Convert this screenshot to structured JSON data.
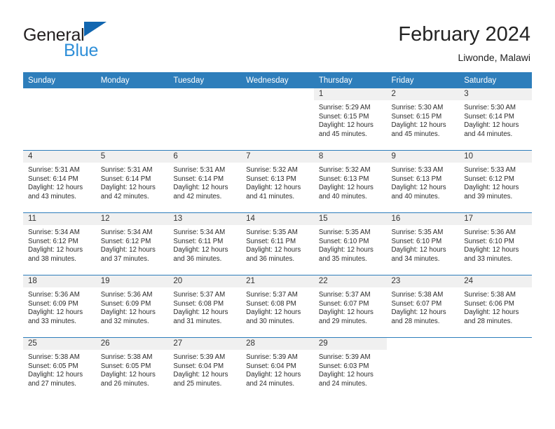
{
  "brand": {
    "name_top": "General",
    "name_bottom": "Blue",
    "triangle_color": "#1166b0",
    "bottom_color": "#2f8fd8"
  },
  "header": {
    "title": "February 2024",
    "subtitle": "Liwonde, Malawi"
  },
  "theme": {
    "header_bg": "#2e7ebb",
    "daynum_bg": "#f0f0f0",
    "rule_color": "#2e7ebb",
    "text_color": "#2b2b2b"
  },
  "weekday_headers": [
    "Sunday",
    "Monday",
    "Tuesday",
    "Wednesday",
    "Thursday",
    "Friday",
    "Saturday"
  ],
  "weeks": [
    [
      {
        "day": "",
        "blank": true,
        "sunrise": "",
        "sunset": "",
        "daylight1": "",
        "daylight2": ""
      },
      {
        "day": "",
        "blank": true,
        "sunrise": "",
        "sunset": "",
        "daylight1": "",
        "daylight2": ""
      },
      {
        "day": "",
        "blank": true,
        "sunrise": "",
        "sunset": "",
        "daylight1": "",
        "daylight2": ""
      },
      {
        "day": "",
        "blank": true,
        "sunrise": "",
        "sunset": "",
        "daylight1": "",
        "daylight2": ""
      },
      {
        "day": "1",
        "sunrise": "Sunrise: 5:29 AM",
        "sunset": "Sunset: 6:15 PM",
        "daylight1": "Daylight: 12 hours",
        "daylight2": "and 45 minutes."
      },
      {
        "day": "2",
        "sunrise": "Sunrise: 5:30 AM",
        "sunset": "Sunset: 6:15 PM",
        "daylight1": "Daylight: 12 hours",
        "daylight2": "and 45 minutes."
      },
      {
        "day": "3",
        "sunrise": "Sunrise: 5:30 AM",
        "sunset": "Sunset: 6:14 PM",
        "daylight1": "Daylight: 12 hours",
        "daylight2": "and 44 minutes."
      }
    ],
    [
      {
        "day": "4",
        "sunrise": "Sunrise: 5:31 AM",
        "sunset": "Sunset: 6:14 PM",
        "daylight1": "Daylight: 12 hours",
        "daylight2": "and 43 minutes."
      },
      {
        "day": "5",
        "sunrise": "Sunrise: 5:31 AM",
        "sunset": "Sunset: 6:14 PM",
        "daylight1": "Daylight: 12 hours",
        "daylight2": "and 42 minutes."
      },
      {
        "day": "6",
        "sunrise": "Sunrise: 5:31 AM",
        "sunset": "Sunset: 6:14 PM",
        "daylight1": "Daylight: 12 hours",
        "daylight2": "and 42 minutes."
      },
      {
        "day": "7",
        "sunrise": "Sunrise: 5:32 AM",
        "sunset": "Sunset: 6:13 PM",
        "daylight1": "Daylight: 12 hours",
        "daylight2": "and 41 minutes."
      },
      {
        "day": "8",
        "sunrise": "Sunrise: 5:32 AM",
        "sunset": "Sunset: 6:13 PM",
        "daylight1": "Daylight: 12 hours",
        "daylight2": "and 40 minutes."
      },
      {
        "day": "9",
        "sunrise": "Sunrise: 5:33 AM",
        "sunset": "Sunset: 6:13 PM",
        "daylight1": "Daylight: 12 hours",
        "daylight2": "and 40 minutes."
      },
      {
        "day": "10",
        "sunrise": "Sunrise: 5:33 AM",
        "sunset": "Sunset: 6:12 PM",
        "daylight1": "Daylight: 12 hours",
        "daylight2": "and 39 minutes."
      }
    ],
    [
      {
        "day": "11",
        "sunrise": "Sunrise: 5:34 AM",
        "sunset": "Sunset: 6:12 PM",
        "daylight1": "Daylight: 12 hours",
        "daylight2": "and 38 minutes."
      },
      {
        "day": "12",
        "sunrise": "Sunrise: 5:34 AM",
        "sunset": "Sunset: 6:12 PM",
        "daylight1": "Daylight: 12 hours",
        "daylight2": "and 37 minutes."
      },
      {
        "day": "13",
        "sunrise": "Sunrise: 5:34 AM",
        "sunset": "Sunset: 6:11 PM",
        "daylight1": "Daylight: 12 hours",
        "daylight2": "and 36 minutes."
      },
      {
        "day": "14",
        "sunrise": "Sunrise: 5:35 AM",
        "sunset": "Sunset: 6:11 PM",
        "daylight1": "Daylight: 12 hours",
        "daylight2": "and 36 minutes."
      },
      {
        "day": "15",
        "sunrise": "Sunrise: 5:35 AM",
        "sunset": "Sunset: 6:10 PM",
        "daylight1": "Daylight: 12 hours",
        "daylight2": "and 35 minutes."
      },
      {
        "day": "16",
        "sunrise": "Sunrise: 5:35 AM",
        "sunset": "Sunset: 6:10 PM",
        "daylight1": "Daylight: 12 hours",
        "daylight2": "and 34 minutes."
      },
      {
        "day": "17",
        "sunrise": "Sunrise: 5:36 AM",
        "sunset": "Sunset: 6:10 PM",
        "daylight1": "Daylight: 12 hours",
        "daylight2": "and 33 minutes."
      }
    ],
    [
      {
        "day": "18",
        "sunrise": "Sunrise: 5:36 AM",
        "sunset": "Sunset: 6:09 PM",
        "daylight1": "Daylight: 12 hours",
        "daylight2": "and 33 minutes."
      },
      {
        "day": "19",
        "sunrise": "Sunrise: 5:36 AM",
        "sunset": "Sunset: 6:09 PM",
        "daylight1": "Daylight: 12 hours",
        "daylight2": "and 32 minutes."
      },
      {
        "day": "20",
        "sunrise": "Sunrise: 5:37 AM",
        "sunset": "Sunset: 6:08 PM",
        "daylight1": "Daylight: 12 hours",
        "daylight2": "and 31 minutes."
      },
      {
        "day": "21",
        "sunrise": "Sunrise: 5:37 AM",
        "sunset": "Sunset: 6:08 PM",
        "daylight1": "Daylight: 12 hours",
        "daylight2": "and 30 minutes."
      },
      {
        "day": "22",
        "sunrise": "Sunrise: 5:37 AM",
        "sunset": "Sunset: 6:07 PM",
        "daylight1": "Daylight: 12 hours",
        "daylight2": "and 29 minutes."
      },
      {
        "day": "23",
        "sunrise": "Sunrise: 5:38 AM",
        "sunset": "Sunset: 6:07 PM",
        "daylight1": "Daylight: 12 hours",
        "daylight2": "and 28 minutes."
      },
      {
        "day": "24",
        "sunrise": "Sunrise: 5:38 AM",
        "sunset": "Sunset: 6:06 PM",
        "daylight1": "Daylight: 12 hours",
        "daylight2": "and 28 minutes."
      }
    ],
    [
      {
        "day": "25",
        "sunrise": "Sunrise: 5:38 AM",
        "sunset": "Sunset: 6:05 PM",
        "daylight1": "Daylight: 12 hours",
        "daylight2": "and 27 minutes."
      },
      {
        "day": "26",
        "sunrise": "Sunrise: 5:38 AM",
        "sunset": "Sunset: 6:05 PM",
        "daylight1": "Daylight: 12 hours",
        "daylight2": "and 26 minutes."
      },
      {
        "day": "27",
        "sunrise": "Sunrise: 5:39 AM",
        "sunset": "Sunset: 6:04 PM",
        "daylight1": "Daylight: 12 hours",
        "daylight2": "and 25 minutes."
      },
      {
        "day": "28",
        "sunrise": "Sunrise: 5:39 AM",
        "sunset": "Sunset: 6:04 PM",
        "daylight1": "Daylight: 12 hours",
        "daylight2": "and 24 minutes."
      },
      {
        "day": "29",
        "sunrise": "Sunrise: 5:39 AM",
        "sunset": "Sunset: 6:03 PM",
        "daylight1": "Daylight: 12 hours",
        "daylight2": "and 24 minutes."
      },
      {
        "day": "",
        "blank": true,
        "sunrise": "",
        "sunset": "",
        "daylight1": "",
        "daylight2": ""
      },
      {
        "day": "",
        "blank": true,
        "sunrise": "",
        "sunset": "",
        "daylight1": "",
        "daylight2": ""
      }
    ]
  ]
}
